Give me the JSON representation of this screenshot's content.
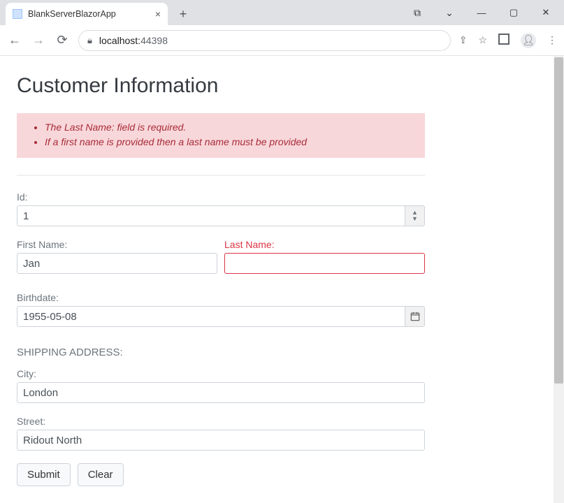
{
  "browser": {
    "tab_title": "BlankServerBlazorApp",
    "url_host": "localhost:",
    "url_port": "44398"
  },
  "page": {
    "heading": "Customer Information",
    "validation_errors": [
      "The Last Name: field is required.",
      "If a first name is provided then a last name must be provided"
    ],
    "fields": {
      "id_label": "Id:",
      "id_value": "1",
      "first_name_label": "First Name:",
      "first_name_value": "Jan",
      "last_name_label": "Last Name:",
      "last_name_value": "",
      "birthdate_label": "Birthdate:",
      "birthdate_value": "1955-05-08",
      "shipping_heading": "SHIPPING ADDRESS:",
      "city_label": "City:",
      "city_value": "London",
      "street_label": "Street:",
      "street_value": "Ridout North"
    },
    "buttons": {
      "submit": "Submit",
      "clear": "Clear"
    }
  }
}
